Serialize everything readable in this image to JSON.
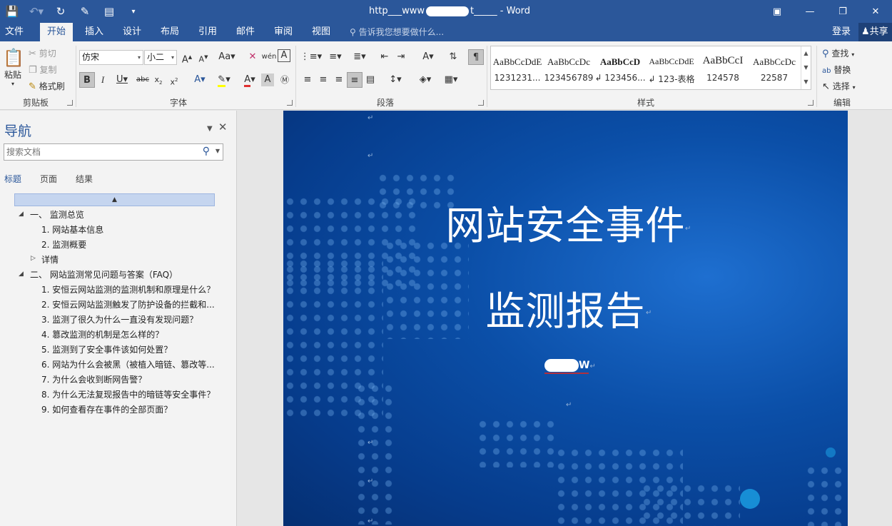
{
  "window": {
    "title_prefix": "http___www",
    "title_mid": "t_____",
    "title_suffix": "- Word"
  },
  "tabs": [
    {
      "label": "文件"
    },
    {
      "label": "开始"
    },
    {
      "label": "插入"
    },
    {
      "label": "设计"
    },
    {
      "label": "布局"
    },
    {
      "label": "引用"
    },
    {
      "label": "邮件"
    },
    {
      "label": "审阅"
    },
    {
      "label": "视图"
    }
  ],
  "tell_me": "告诉我您想要做什么...",
  "account": {
    "login": "登录",
    "share": "共享"
  },
  "clipboard": {
    "paste": "粘贴",
    "cut": "剪切",
    "copy": "复制",
    "format_painter": "格式刷",
    "group": "剪贴板"
  },
  "font": {
    "name": "仿宋",
    "size": "小二",
    "group": "字体"
  },
  "paragraph": {
    "group": "段落"
  },
  "styles": {
    "group": "样式",
    "items": [
      {
        "sample": "AaBbCcDdE",
        "name": "1231231..."
      },
      {
        "sample": "AaBbCcDc",
        "name": "123456789"
      },
      {
        "sample": "AaBbCcD",
        "name": "↲ 123456..."
      },
      {
        "sample": "AaBbCcDdE",
        "name": "↲ 123-表格"
      },
      {
        "sample": "AaBbCcI",
        "name": "124578"
      },
      {
        "sample": "AaBbCcDc",
        "name": "22587"
      }
    ]
  },
  "editing": {
    "find": "查找",
    "replace": "替换",
    "select": "选择",
    "group": "编辑"
  },
  "nav": {
    "title": "导航",
    "search_placeholder": "搜索文档",
    "tabs": [
      "标题",
      "页面",
      "结果"
    ],
    "headings": [
      {
        "text": "一、 监测总览",
        "level": 1
      },
      {
        "text": "1. 网站基本信息",
        "level": 2
      },
      {
        "text": "2. 监测概要",
        "level": 2
      },
      {
        "text": "详情",
        "level": 2
      },
      {
        "text": "二、 网站监测常见问题与答案（FAQ）",
        "level": 1
      },
      {
        "text": "1. 安恒云网站监测的监测机制和原理是什么？",
        "level": 2
      },
      {
        "text": "2. 安恒云网站监测触发了防护设备的拦截和...",
        "level": 2
      },
      {
        "text": "3. 监测了很久为什么一直没有发现问题？",
        "level": 2
      },
      {
        "text": "4. 篡改监测的机制是怎么样的？",
        "level": 2
      },
      {
        "text": "5. 监测到了安全事件该如何处置？",
        "level": 2
      },
      {
        "text": "6. 网站为什么会被黑（被植入暗链、篡改等...",
        "level": 2
      },
      {
        "text": "7. 为什么会收到断网告警？",
        "level": 2
      },
      {
        "text": "8. 为什么无法复现报告中的暗链等安全事件？",
        "level": 2
      },
      {
        "text": "9. 如何查看存在事件的全部页面？",
        "level": 2
      }
    ]
  },
  "document": {
    "title_line1": "网站安全事件",
    "title_line2": "监测报告",
    "company_suffix": "W",
    "para_mark": "↵"
  },
  "colors": {
    "accent": "#2b579a",
    "page_blue": "#0b4fa8"
  }
}
